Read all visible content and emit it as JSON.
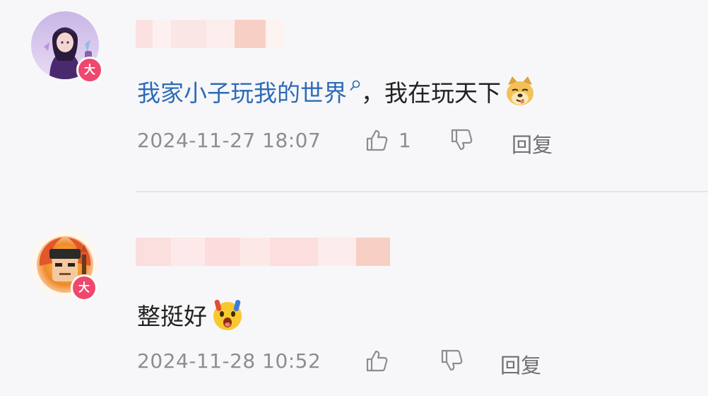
{
  "colors": {
    "background": "#f7f7f9",
    "link": "#2d6bb8",
    "meta_text": "#8c8c94",
    "badge": "#f0476e",
    "divider": "#e4e4ea"
  },
  "comments": [
    {
      "avatar_icon": "anime-character-avatar",
      "badge_label": "大",
      "content": {
        "link_text": "我家小子玩我的世界",
        "link_icon": "search-icon",
        "text": "，我在玩天下",
        "emoji": "doge-emoji"
      },
      "timestamp": "2024-11-27 18:07",
      "like_count": "1",
      "reply_label": "回复"
    },
    {
      "avatar_icon": "fire-character-avatar",
      "badge_label": "大",
      "content": {
        "text": "整挺好",
        "emoji": "shocked-emoji"
      },
      "timestamp": "2024-11-28 10:52",
      "like_count": "",
      "reply_label": "回复"
    }
  ]
}
